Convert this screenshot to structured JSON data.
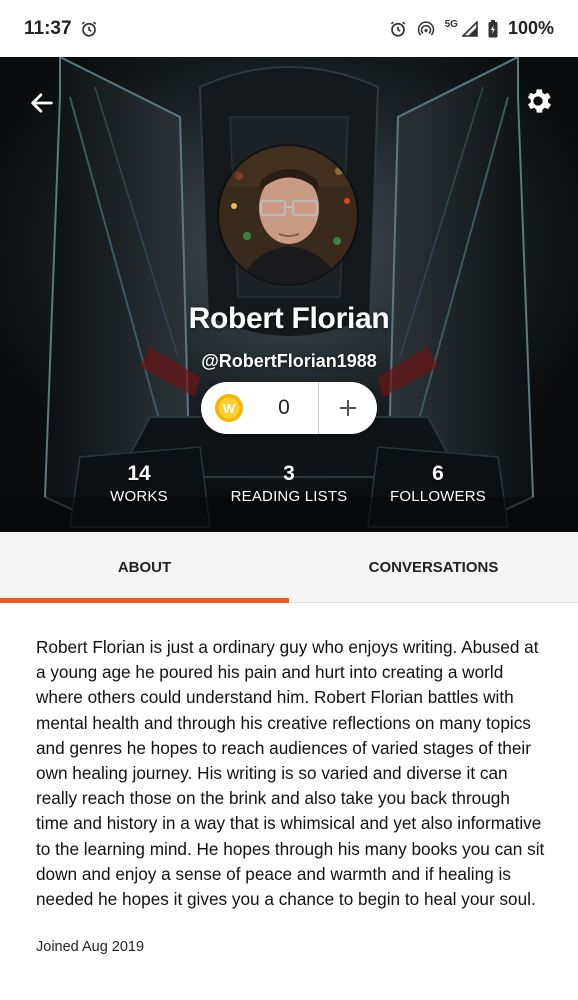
{
  "status_bar": {
    "time": "11:37",
    "network": "5G",
    "battery": "100%"
  },
  "header": {
    "back_icon": "arrow-left-icon",
    "settings_icon": "gear-icon"
  },
  "profile": {
    "name": "Robert Florian",
    "handle": "@RobertFlorian1988",
    "coins": "0",
    "coin_icon": "w-coin-icon",
    "add_icon": "plus-icon"
  },
  "stats": [
    {
      "value": "14",
      "label": "WORKS"
    },
    {
      "value": "3",
      "label": "READING LISTS"
    },
    {
      "value": "6",
      "label": "FOLLOWERS"
    }
  ],
  "tabs": [
    {
      "label": "ABOUT",
      "active": true
    },
    {
      "label": "CONVERSATIONS",
      "active": false
    }
  ],
  "about": {
    "description": "Robert Florian is just a ordinary guy who enjoys writing. Abused at a young age he poured his pain and hurt into creating a world where others could understand him. Robert Florian battles with mental health and through his creative reflections on many topics and genres he hopes to reach audiences of varied stages of their own healing journey. His writing is so varied and diverse it can really reach those on the brink and also take you back through time and history in a way that is whimsical and yet also informative to the learning mind. He hopes through his many books you can sit down and enjoy a sense of peace and warmth and if healing is needed he hopes it gives you a chance to begin to heal your soul.",
    "joined": "Joined Aug 2019"
  },
  "colors": {
    "accent": "#ee5a24",
    "coin": "#f5b400"
  }
}
